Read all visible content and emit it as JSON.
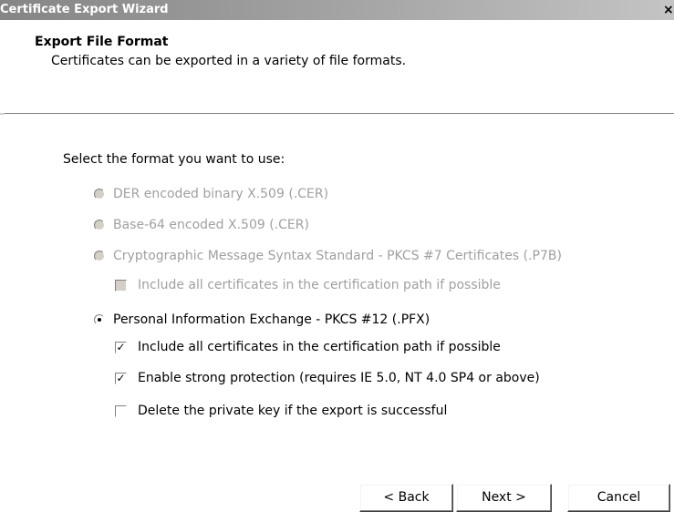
{
  "window": {
    "title": "Certificate Export Wizard",
    "close_glyph": "×"
  },
  "header": {
    "title": "Export File Format",
    "subtitle": "Certificates can be exported in a variety of file formats."
  },
  "prompt": "Select the format you want to use:",
  "options": [
    {
      "label": "DER encoded binary X.509 (.CER)",
      "selected": false,
      "enabled": false
    },
    {
      "label": "Base-64 encoded X.509 (.CER)",
      "selected": false,
      "enabled": false
    },
    {
      "label": "Cryptographic Message Syntax Standard - PKCS #7 Certificates (.P7B)",
      "selected": false,
      "enabled": false
    },
    {
      "label": "Personal Information Exchange - PKCS #12 (.PFX)",
      "selected": true,
      "enabled": true
    }
  ],
  "p7b_suboptions": [
    {
      "label": "Include all certificates in the certification path if possible",
      "checked": false,
      "enabled": false
    }
  ],
  "pfx_suboptions": [
    {
      "label": "Include all certificates in the certification path if possible",
      "checked": true,
      "enabled": true
    },
    {
      "label": "Enable strong protection (requires IE 5.0, NT 4.0 SP4 or above)",
      "checked": true,
      "enabled": true
    },
    {
      "label": "Delete the private key if the export is successful",
      "checked": false,
      "enabled": true
    }
  ],
  "buttons": {
    "back": "< Back",
    "next": "Next >",
    "cancel": "Cancel"
  },
  "check_glyph": "✓"
}
